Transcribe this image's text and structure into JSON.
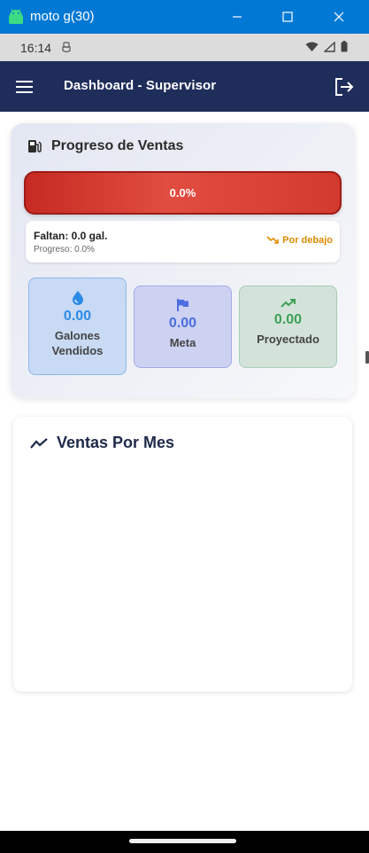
{
  "window": {
    "title": "moto g(30)"
  },
  "status_bar": {
    "time": "16:14"
  },
  "app_bar": {
    "title": "Dashboard - Supervisor"
  },
  "progress_card": {
    "title": "Progreso de Ventas",
    "progress_fraction": 0.0,
    "progress_label": "0.0%",
    "faltan": "Faltan: 0.0 gal.",
    "progreso": "Progreso: 0.0%",
    "status": "Por debajo",
    "stats": [
      {
        "value": "0.00",
        "label": "Galones Vendidos",
        "icon": "water-drop-icon"
      },
      {
        "value": "0.00",
        "label": "Meta",
        "icon": "flag-icon"
      },
      {
        "value": "0.00",
        "label": "Proyectado",
        "icon": "trending-up-icon"
      }
    ]
  },
  "sales_card": {
    "title": "Ventas Por Mes"
  },
  "colors": {
    "windows_titlebar": "#0078d4",
    "appbar": "#1f2d5a",
    "progress_bar": "#d33a2e",
    "status_warning": "#e08a00"
  }
}
